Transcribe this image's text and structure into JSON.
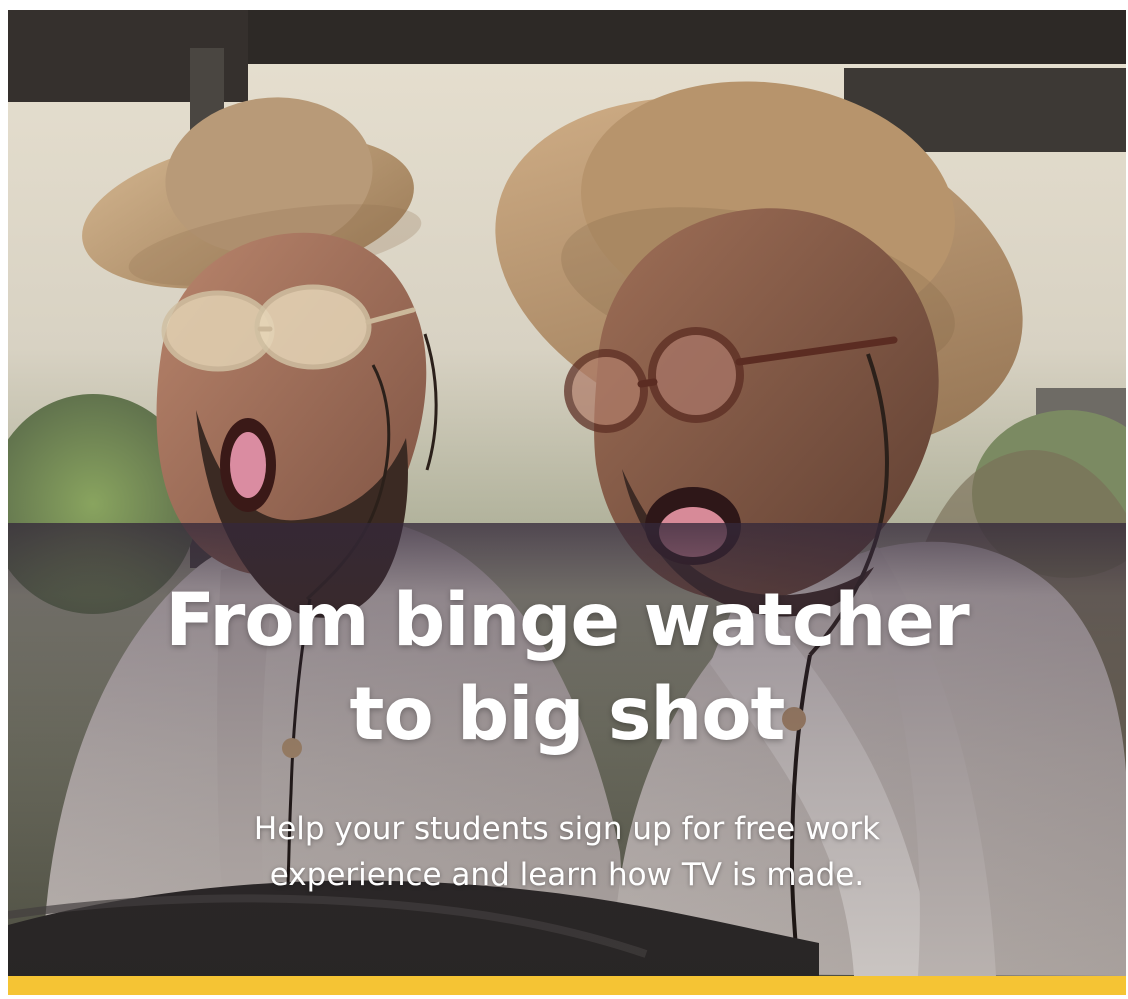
{
  "hero": {
    "headline": {
      "line1": "From binge watcher",
      "line2": "to big shot"
    },
    "subheadline": {
      "line1": "Help your students sign up for free work",
      "line2": "experience and learn how TV is made."
    }
  },
  "colors": {
    "accent_bar": "#f5c434",
    "overlay": "#34283a",
    "text": "#ffffff"
  }
}
